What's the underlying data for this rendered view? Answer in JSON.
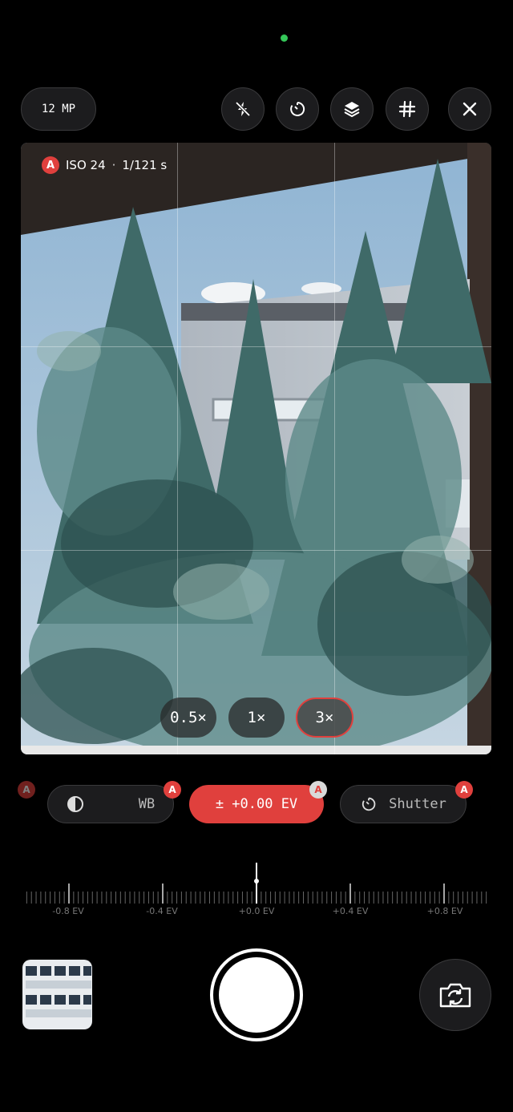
{
  "top_bar": {
    "resolution_label": "12 MP",
    "icons": [
      "flash-off-icon",
      "timer-icon",
      "layers-icon",
      "grid-icon",
      "close-icon"
    ]
  },
  "viewfinder": {
    "auto_badge": "A",
    "iso_label": "ISO 24",
    "separator": "·",
    "shutter_label": "1/121 s"
  },
  "zoom": {
    "options": [
      "0.5×",
      "1×",
      "3×"
    ],
    "selected": "3×"
  },
  "controls": {
    "wb_label": "WB",
    "wb_auto": "A",
    "ev_label": "± +0.00 EV",
    "ev_auto": "A",
    "shutter_label": "Shutter",
    "shutter_auto": "A",
    "left_partial_auto": "A"
  },
  "ev_ruler": {
    "labels": [
      "-0.8 EV",
      "-0.4 EV",
      "+0.0 EV",
      "+0.4 EV",
      "+0.8 EV"
    ],
    "current_value": 0.0
  },
  "bottom": {
    "shutter_button": "shutter",
    "thumbnail": "last-photo",
    "flip_icon": "flip-camera-icon"
  },
  "colors": {
    "accent": "#e0403d",
    "status_dot": "#35c759"
  }
}
